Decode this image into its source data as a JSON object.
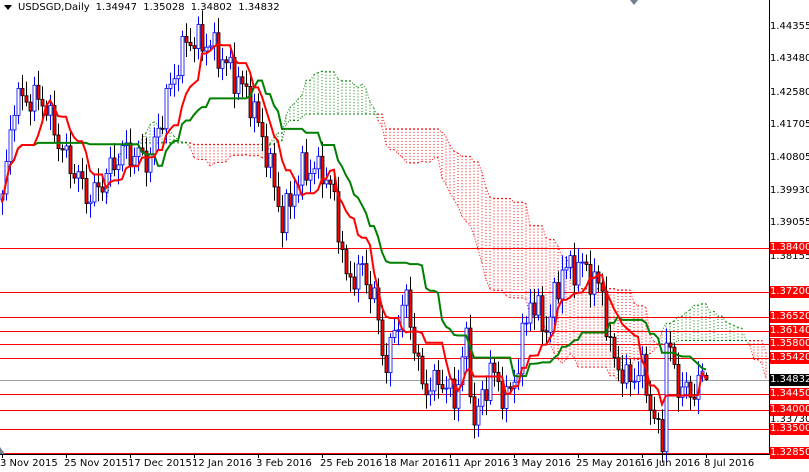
{
  "header": {
    "symbol": "USDSGD,Daily",
    "open": "1.34947",
    "high": "1.35028",
    "low": "1.34802",
    "close": "1.34832"
  },
  "colors": {
    "bull": "#0000ff",
    "bear_body": "#ff0000",
    "bear_wick": "#000000",
    "tenkan": "#ff0000",
    "kijun": "#008000",
    "cloud_up": "#008000",
    "cloud_down": "#ff0000",
    "level_line": "#ff0000",
    "current_line": "#a0a0a0"
  },
  "chart_data": {
    "type": "candlestick",
    "title": "USDSGD,Daily",
    "indicator": "Ichimoku Kinko Hyo (9, 26, 52)",
    "ylim": [
      1.3255,
      1.451
    ],
    "y_ticks": [
      "1.44355",
      "1.43480",
      "1.42580",
      "1.41705",
      "1.40805",
      "1.39930",
      "1.39055",
      "1.38155",
      "1.33730"
    ],
    "x_ticks": [
      {
        "bar": 0,
        "label": "3 Nov 2015"
      },
      {
        "bar": 16,
        "label": "25 Nov 2015"
      },
      {
        "bar": 32,
        "label": "17 Dec 2015"
      },
      {
        "bar": 48,
        "label": "12 Jan 2016"
      },
      {
        "bar": 64,
        "label": "3 Feb 2016"
      },
      {
        "bar": 80,
        "label": "25 Feb 2016"
      },
      {
        "bar": 96,
        "label": "18 Mar 2016"
      },
      {
        "bar": 112,
        "label": "11 Apr 2016"
      },
      {
        "bar": 128,
        "label": "3 May 2016"
      },
      {
        "bar": 144,
        "label": "25 May 2016"
      },
      {
        "bar": 160,
        "label": "16 Jun 2016"
      },
      {
        "bar": 176,
        "label": "8 Jul 2016"
      }
    ],
    "close_path": [
      [
        0,
        1.3968
      ],
      [
        3,
        1.424
      ],
      [
        10,
        1.424
      ],
      [
        15,
        1.41
      ],
      [
        22,
        1.397
      ],
      [
        30,
        1.41
      ],
      [
        37,
        1.408
      ],
      [
        41,
        1.424
      ],
      [
        46,
        1.44
      ],
      [
        52,
        1.439
      ],
      [
        57,
        1.432
      ],
      [
        62,
        1.424
      ],
      [
        66,
        1.41
      ],
      [
        70,
        1.391
      ],
      [
        75,
        1.405
      ],
      [
        80,
        1.405
      ],
      [
        83,
        1.397
      ],
      [
        86,
        1.375
      ],
      [
        90,
        1.378
      ],
      [
        93,
        1.37
      ],
      [
        96,
        1.351
      ],
      [
        98,
        1.362
      ],
      [
        101,
        1.37
      ],
      [
        105,
        1.346
      ],
      [
        110,
        1.348
      ],
      [
        113,
        1.343
      ],
      [
        116,
        1.359
      ],
      [
        118,
        1.336
      ],
      [
        122,
        1.351
      ],
      [
        126,
        1.343
      ],
      [
        128,
        1.348
      ],
      [
        132,
        1.37
      ],
      [
        136,
        1.362
      ],
      [
        140,
        1.378
      ],
      [
        145,
        1.379
      ],
      [
        150,
        1.372
      ],
      [
        152,
        1.356
      ],
      [
        156,
        1.348
      ],
      [
        160,
        1.351
      ],
      [
        163,
        1.337
      ],
      [
        165,
        1.332
      ],
      [
        166,
        1.359
      ],
      [
        169,
        1.347
      ],
      [
        172,
        1.344
      ],
      [
        174,
        1.348
      ],
      [
        176,
        1.34832
      ]
    ],
    "last_bar": {
      "open": 1.34947,
      "high": 1.35028,
      "low": 1.34802,
      "close": 1.34832
    },
    "levels": [
      "1.38400",
      "1.37200",
      "1.36520",
      "1.36140",
      "1.35800",
      "1.35420",
      "1.34450",
      "1.34000",
      "1.33500",
      "1.32850"
    ],
    "current_price": "1.34832"
  }
}
